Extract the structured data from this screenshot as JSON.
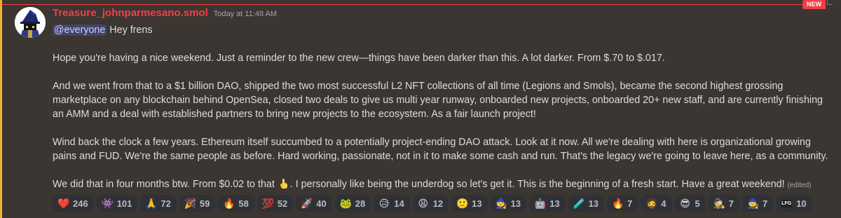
{
  "message": {
    "username": "Treasure_johnparmesano.smol",
    "timestamp": "Today at 11:48 AM",
    "new_badge": "NEW",
    "mention": "@everyone",
    "greeting": " Hey frens",
    "para1": "Hope you're having a nice weekend. Just a reminder to the new crew—things have been darker than this. A lot darker. From $.70 to $.017.",
    "para2": "And we went from that to a $1 billion DAO, shipped the two most successful L2 NFT collections of all time (Legions and Smols), became the second highest grossing marketplace on any blockchain behind OpenSea, closed two deals to give us multi year runway, onboarded new projects, onboarded 20+ new staff, and are currently finishing an AMM and a deal with established partners to bring new projects to the ecosystem. As a fair launch project!",
    "para3": "Wind back the clock a few years. Ethereum itself succumbed to a potentially project-ending DAO attack. Look at it now. All we're dealing with here is organizational growing pains and FUD. We're the same people as before. Hard working, passionate, not in it to make some cash and run. That's the legacy we're going to leave here, as a community.",
    "para4_a": "We did that in four months btw. From $0.02 to that ",
    "para4_b": ". I personally like being the underdog so let's get it. This is the beginning of a fresh start. Have a great weekend! ",
    "edited": "(edited)"
  },
  "reactions": [
    {
      "icon": "red-heart-icon",
      "glyph": "❤️",
      "count": "246"
    },
    {
      "icon": "custom-emoji-icon",
      "glyph": "👾",
      "count": "101"
    },
    {
      "icon": "praying-hands-icon",
      "glyph": "🙏",
      "count": "72"
    },
    {
      "icon": "party-popper-icon",
      "glyph": "🎉",
      "count": "59"
    },
    {
      "icon": "fire-icon",
      "glyph": "🔥",
      "count": "58"
    },
    {
      "icon": "hundred-points-icon",
      "glyph": "💯",
      "count": "52"
    },
    {
      "icon": "rocket-icon",
      "glyph": "🚀",
      "count": "40"
    },
    {
      "icon": "custom-emoji-icon",
      "glyph": "🐸",
      "count": "28"
    },
    {
      "icon": "disappointed-face-icon",
      "glyph": "😥",
      "count": "14"
    },
    {
      "icon": "weary-face-icon",
      "glyph": "😩",
      "count": "12"
    },
    {
      "icon": "smiling-face-icon",
      "glyph": "🙂",
      "count": "13"
    },
    {
      "icon": "custom-emoji-icon",
      "glyph": "🧙",
      "count": "13"
    },
    {
      "icon": "custom-emoji-icon",
      "glyph": "🤖",
      "count": "13"
    },
    {
      "icon": "custom-emoji-icon",
      "glyph": "🧪",
      "count": "13"
    },
    {
      "icon": "custom-emoji-icon",
      "glyph": "🔥",
      "count": "7"
    },
    {
      "icon": "custom-emoji-icon",
      "glyph": "🧔",
      "count": "4"
    },
    {
      "icon": "sunglasses-face-icon",
      "glyph": "😎",
      "count": "5"
    },
    {
      "icon": "custom-emoji-icon",
      "glyph": "🕵️",
      "count": "7"
    },
    {
      "icon": "custom-emoji-icon",
      "glyph": "🧙",
      "count": "7"
    },
    {
      "icon": "lfg-icon",
      "glyph": "LFG",
      "count": "10"
    }
  ],
  "colors": {
    "username": "#f23f43",
    "highlight_bg": "#3b3631",
    "highlight_border": "#f0b232",
    "new_badge": "#f23f43"
  }
}
